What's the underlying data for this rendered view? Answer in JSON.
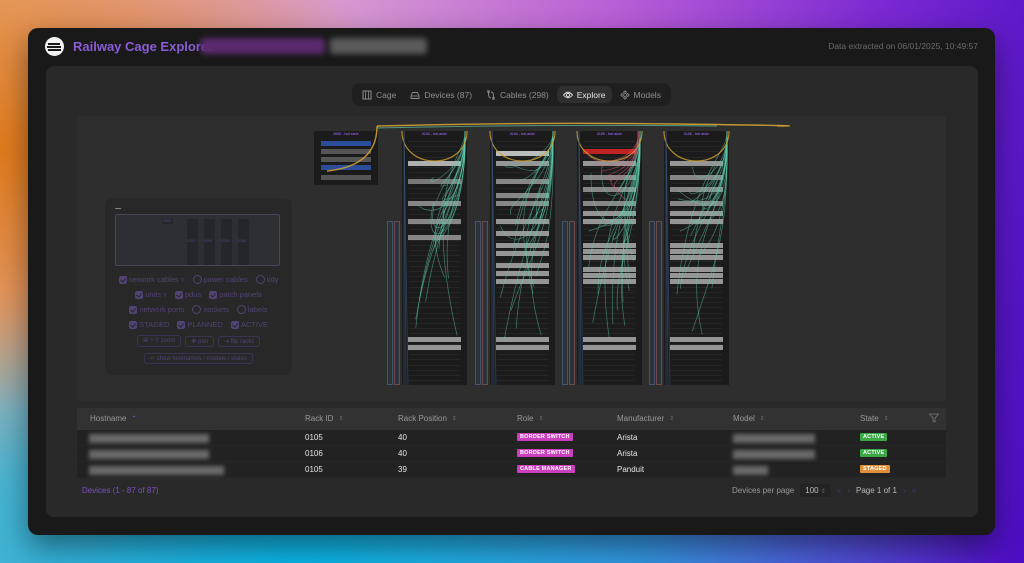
{
  "header": {
    "app_title": "Railway Cage Explorer",
    "extracted": "Data extracted on 06/01/2025, 10:49:57"
  },
  "tabs": [
    {
      "label": "Cage",
      "icon": "cage-icon"
    },
    {
      "label": "Devices (87)",
      "icon": "devices-icon"
    },
    {
      "label": "Cables (298)",
      "icon": "cables-icon"
    },
    {
      "label": "Explore",
      "icon": "eye-icon",
      "active": true
    },
    {
      "label": "Models",
      "icon": "models-icon"
    }
  ],
  "minimap": {
    "racks": [
      "0103",
      "0104",
      "0105",
      "0106"
    ],
    "small": "0000"
  },
  "controls": {
    "row1": [
      {
        "label": "network cables ▿",
        "checked": true,
        "type": "checkbox"
      },
      {
        "label": "power cables",
        "checked": false,
        "type": "radio"
      },
      {
        "label": "tidy",
        "checked": false,
        "type": "radio"
      }
    ],
    "row2": [
      {
        "label": "units ▿",
        "checked": true
      },
      {
        "label": "pdus",
        "checked": true
      },
      {
        "label": "patch panels",
        "checked": true
      }
    ],
    "row3": [
      {
        "label": "network ports",
        "checked": true,
        "type": "checkbox"
      },
      {
        "label": "sockets",
        "checked": false,
        "type": "radio"
      },
      {
        "label": "labels",
        "checked": false,
        "type": "radio"
      }
    ],
    "row4": [
      {
        "label": "STAGED",
        "checked": true
      },
      {
        "label": "PLANNED",
        "checked": true
      },
      {
        "label": "ACTIVE",
        "checked": true
      }
    ],
    "zoom": "⌘ + ⌷ zoom",
    "pan": "✥ pan",
    "flip": "⇥ flip racks",
    "show": "↵ show hostnames / models / states"
  },
  "racks": [
    {
      "label": "0000 - hot aisle"
    },
    {
      "label": "0103 - hot aisle"
    },
    {
      "label": "0104 - hot aisle"
    },
    {
      "label": "0105 - hot aisle"
    },
    {
      "label": "0106 - hot aisle"
    }
  ],
  "table": {
    "columns": [
      "Hostname",
      "Rack ID",
      "Rack Position",
      "Role",
      "Manufacturer",
      "Model",
      "State"
    ],
    "rows": [
      {
        "rack_id": "0105",
        "position": "40",
        "role": "BORDER SWITCH",
        "manufacturer": "Arista",
        "state": "ACTIVE"
      },
      {
        "rack_id": "0106",
        "position": "40",
        "role": "BORDER SWITCH",
        "manufacturer": "Arista",
        "state": "ACTIVE"
      },
      {
        "rack_id": "0105",
        "position": "39",
        "role": "CABLE MANAGER",
        "manufacturer": "Panduit",
        "state": "STAGED"
      }
    ]
  },
  "footer": {
    "count": "Devices (1 - 87 of 87)",
    "per_page_label": "Devices per page",
    "per_page_value": "100",
    "page": "Page 1 of 1"
  },
  "colors": {
    "accent": "#8a5cd6",
    "role_badge": "#c93fbc",
    "active": "#3aa845",
    "staged": "#e0903c"
  }
}
